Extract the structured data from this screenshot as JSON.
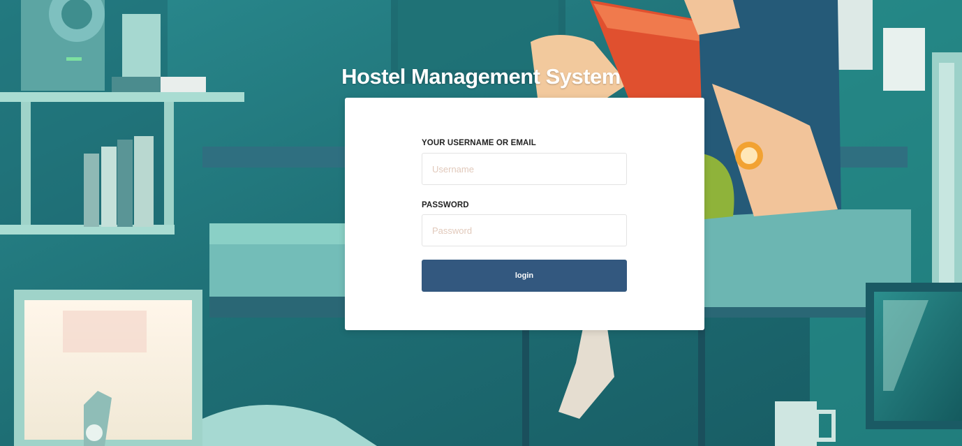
{
  "page": {
    "title": "Hostel Management System"
  },
  "login_form": {
    "username_label": "YOUR USERNAME OR EMAIL",
    "username_placeholder": "Username",
    "username_value": "",
    "password_label": "PASSWORD",
    "password_placeholder": "Password",
    "password_value": "",
    "submit_label": "login"
  },
  "theme": {
    "background": "#1f6f78",
    "card": "#ffffff",
    "button": "#33587f",
    "placeholder": "#e1c9bb"
  }
}
